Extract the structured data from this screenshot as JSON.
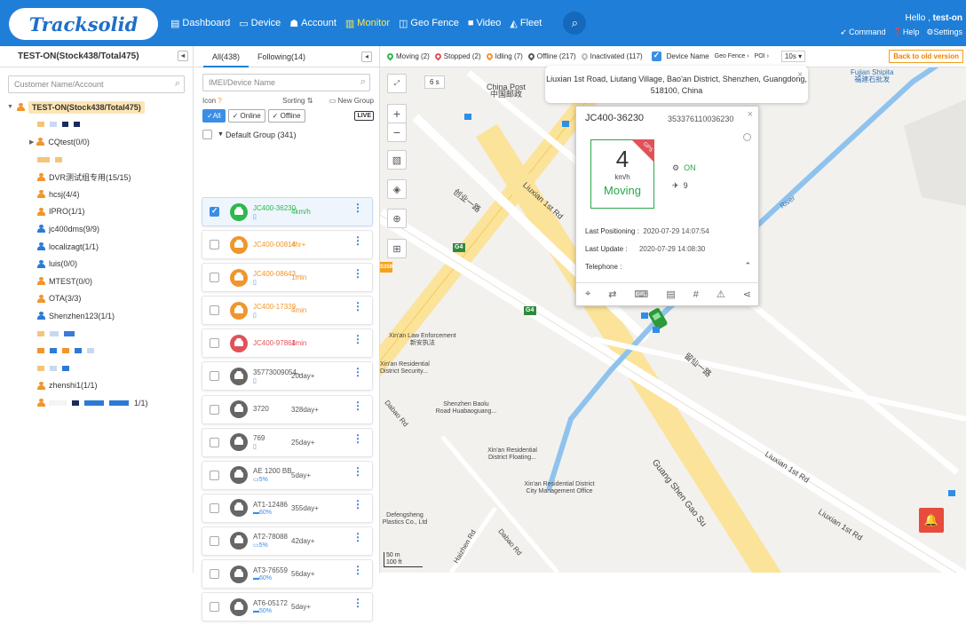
{
  "header": {
    "logo": "Tracksolid",
    "nav": [
      {
        "icon": "▤",
        "label": "Dashboard"
      },
      {
        "icon": "▭",
        "label": "Device"
      },
      {
        "icon": "☗",
        "label": "Account"
      },
      {
        "icon": "▥",
        "label": "Monitor",
        "active": true
      },
      {
        "icon": "◫",
        "label": "Geo Fence"
      },
      {
        "icon": "■",
        "label": "Video"
      },
      {
        "icon": "◭",
        "label": "Fleet"
      }
    ],
    "hello": "Hello ,",
    "user": "test-on",
    "command": "Command",
    "help": "Help",
    "settings": "Settings"
  },
  "left": {
    "title": "TEST-ON(Stock438/Total475)",
    "search_placeholder": "Customer Name/Account",
    "root": "TEST-ON(Stock438/Total475)",
    "nodes": [
      "CQtest(0/0)",
      "DVR测试组专用(15/15)",
      "hcsj(4/4)",
      "IPRO(1/1)",
      "jc400dms(9/9)",
      "localizagt(1/1)",
      "luis(0/0)",
      "MTEST(0/0)",
      "OTA(3/3)",
      "Shenzhen123(1/1)",
      "zhenshi1(1/1)",
      "1/1)"
    ]
  },
  "mid": {
    "tab_all": "All(438)",
    "tab_following": "Following(14)",
    "search_placeholder": "IMEI/Device Name",
    "icon_label": "Icon",
    "sorting": "Sorting",
    "new_group": "New Group",
    "filter_all": "All",
    "filter_online": "Online",
    "filter_offline": "Offline",
    "live": "LIVE",
    "group": "Default Group (341)",
    "devices": [
      {
        "name": "JC400-36230",
        "sub": "▯",
        "time": "4km/h",
        "color": "#2db84b",
        "textcolor": "#2db84b",
        "checked": true
      },
      {
        "name": "JC400-00814",
        "sub": "",
        "time": "4hr+",
        "color": "#f0962c",
        "textcolor": "#f0962c"
      },
      {
        "name": "JC400-08643...",
        "sub": "▯",
        "time": "1min",
        "color": "#f0962c",
        "textcolor": "#f0962c"
      },
      {
        "name": "JC400-17339",
        "sub": "▯",
        "time": "4min",
        "color": "#f0962c",
        "textcolor": "#f0962c"
      },
      {
        "name": "JC400-97864",
        "sub": "",
        "time": "1min",
        "color": "#e0525a",
        "textcolor": "#e0525a"
      },
      {
        "name": "35773009054...",
        "sub": "▯",
        "time": "20day+",
        "color": "#666666",
        "textcolor": "#555555"
      },
      {
        "name": "3720",
        "sub": "",
        "time": "328day+",
        "color": "#666666",
        "textcolor": "#555555"
      },
      {
        "name": "769",
        "sub": "▯",
        "time": "25day+",
        "color": "#666666",
        "textcolor": "#555555"
      },
      {
        "name": "AE 1200 BB",
        "sub": "▭5%",
        "time": "5day+",
        "color": "#666666",
        "textcolor": "#555555"
      },
      {
        "name": "AT1-12486",
        "sub": "▬60%",
        "time": "355day+",
        "color": "#666666",
        "textcolor": "#555555"
      },
      {
        "name": "AT2-78088",
        "sub": "▭5%",
        "time": "42day+",
        "color": "#666666",
        "textcolor": "#555555"
      },
      {
        "name": "AT3-76559",
        "sub": "▬60%",
        "time": "56day+",
        "color": "#666666",
        "textcolor": "#555555"
      },
      {
        "name": "AT6-05172",
        "sub": "▬50%",
        "time": "5day+",
        "color": "#666666",
        "textcolor": "#555555"
      }
    ]
  },
  "mapbar": {
    "moving": "Moving (2)",
    "stopped": "Stopped (2)",
    "idling": "Idling (7)",
    "offline": "Offline (217)",
    "inactivated": "Inactivated (117)",
    "device_name": "Device Name",
    "geo_fence": "Geo Fence",
    "poi": "POI",
    "interval": "10s",
    "old_version": "Back to old version"
  },
  "map": {
    "refresh": "6 s",
    "labels": [
      "China Post",
      "中国邮政",
      "Fujian Shipita",
      "福建石批发",
      "创业一路",
      "Liuxian 1st Rd",
      "Xin'an Law Enforcement",
      "新安执法",
      "Xin'an Residential District Security...",
      "Shenzhen Baolu Road Huabaoguang...",
      "Dabao Rd",
      "Xin'an Residential District Floating...",
      "Xin'an Residential District City Management Office",
      "Defengsheng Plastics Co., Ltd",
      "Guang Shen Gao Su",
      "Liuxian 1st Rd",
      "Liuxian 1st Rd",
      "留仙一路",
      "Haizhen Rd",
      "Dabao Rd",
      "River",
      "G4",
      "G4",
      "S359"
    ],
    "scale_50": "50 m",
    "scale_100": "100 ft"
  },
  "popup": {
    "address": "Liuxian 1st Road, Liutang Village, Bao'an District, Shenzhen, Guangdong, 518100, China",
    "device": "JC400-36230",
    "imei": "353376110036230",
    "speed": "4",
    "unit": "km/h",
    "status": "Moving",
    "gps": "GPS",
    "acc": "ON",
    "satellites": "9",
    "last_positioning_label": "Last Positioning :",
    "last_positioning": "2020-07-29 14:07:54",
    "last_update_label": "Last Update :",
    "last_update": "2020-07-29 14:08:30",
    "telephone_label": "Telephone :"
  }
}
